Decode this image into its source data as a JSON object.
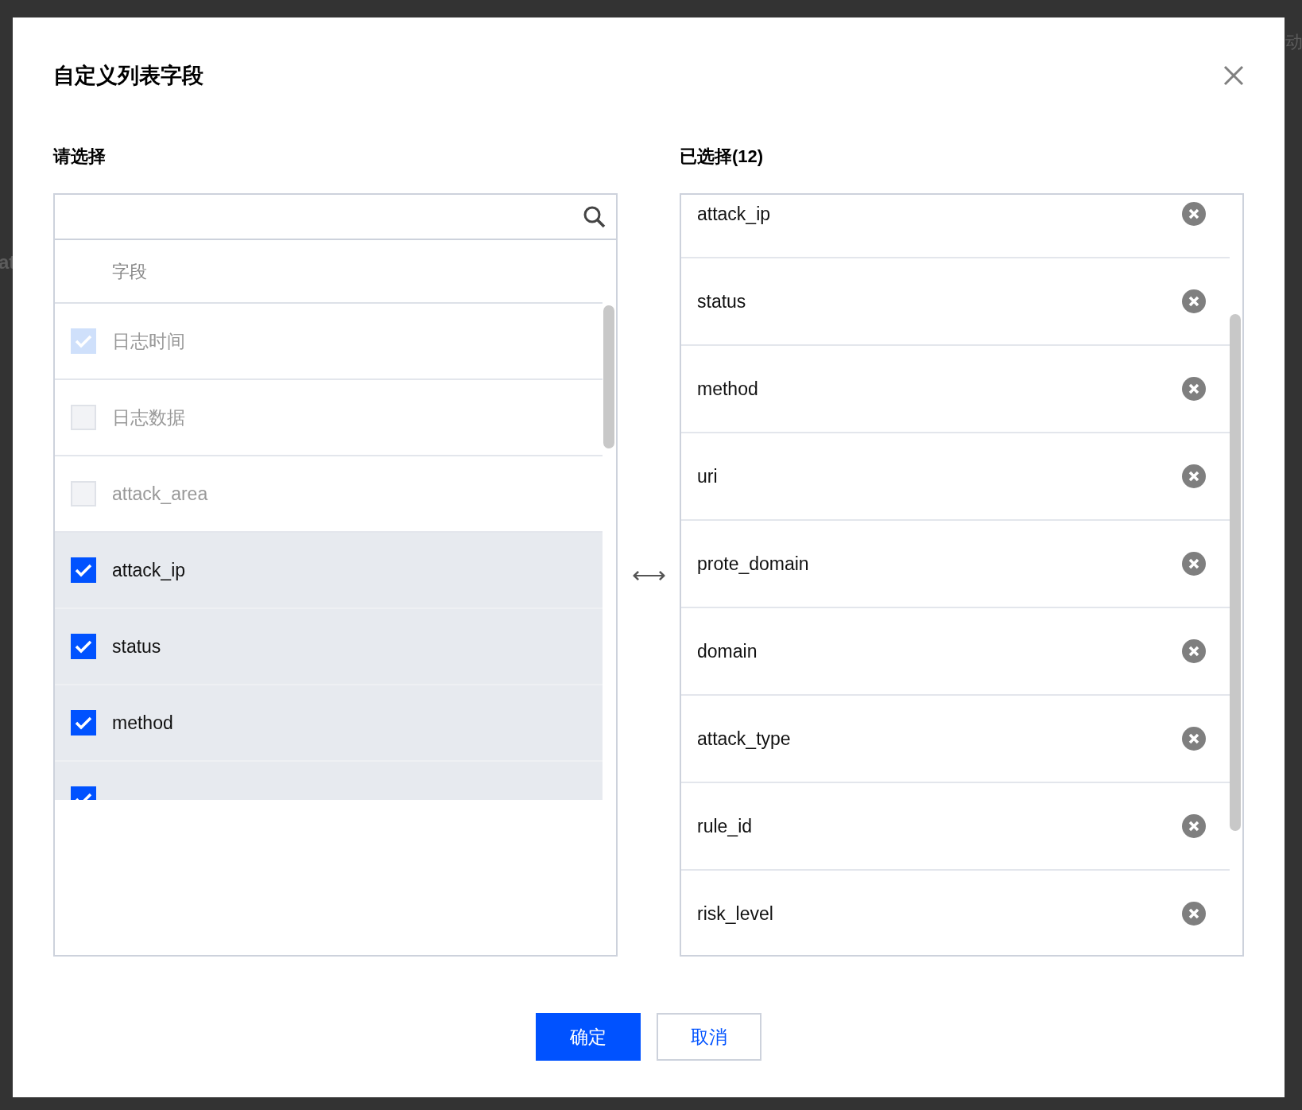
{
  "backdrop": {
    "texts": [
      "at",
      "动"
    ]
  },
  "dialog": {
    "title": "自定义列表字段",
    "left": {
      "label": "请选择",
      "column_header": "字段",
      "items": [
        {
          "label": "日志时间",
          "checked": true,
          "disabled": true
        },
        {
          "label": "日志数据",
          "checked": false,
          "disabled": true
        },
        {
          "label": "attack_area",
          "checked": false,
          "disabled": true
        },
        {
          "label": "attack_ip",
          "checked": true,
          "disabled": false
        },
        {
          "label": "status",
          "checked": true,
          "disabled": false
        },
        {
          "label": "method",
          "checked": true,
          "disabled": false
        },
        {
          "checked": true,
          "disabled": false
        }
      ]
    },
    "transfer_icon": "⟷",
    "right": {
      "label": "已选择(12)",
      "items": [
        "attack_ip",
        "status",
        "method",
        "uri",
        "prote_domain",
        "domain",
        "attack_type",
        "rule_id",
        "risk_level"
      ]
    },
    "buttons": [
      {
        "label": "确定",
        "kind": "primary"
      },
      {
        "label": "取消",
        "kind": "secondary"
      }
    ]
  }
}
